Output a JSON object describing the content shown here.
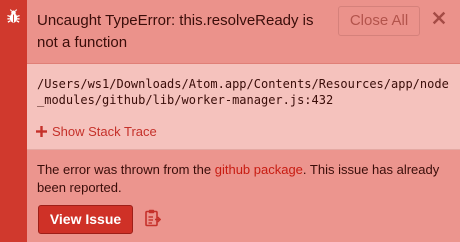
{
  "notification": {
    "type": "error",
    "message": "Uncaught TypeError: this.resolveReady is not a function",
    "close_all_label": "Close All",
    "icons": {
      "type_icon": "bug-icon",
      "dismiss": "close-icon",
      "toggle": "plus-icon",
      "copy": "clipboard-copy-icon"
    },
    "detail": {
      "path": "/Users/ws1/Downloads/Atom.app/Contents/Resources/app/node_modules/github/lib/worker-manager.js:432",
      "stack_trace_label": "Show Stack Trace"
    },
    "meta": {
      "text_before": "The error was thrown from the ",
      "package_link": "github package",
      "text_after": ". This issue has already been reported.",
      "view_issue_label": "View Issue"
    },
    "colors": {
      "stripe": "#d0392d",
      "header_bg": "#eb928b",
      "detail_bg": "#f5c2bd",
      "meta_bg": "#ec958e",
      "link": "#c81c12",
      "button_bg": "#cf3127"
    }
  }
}
